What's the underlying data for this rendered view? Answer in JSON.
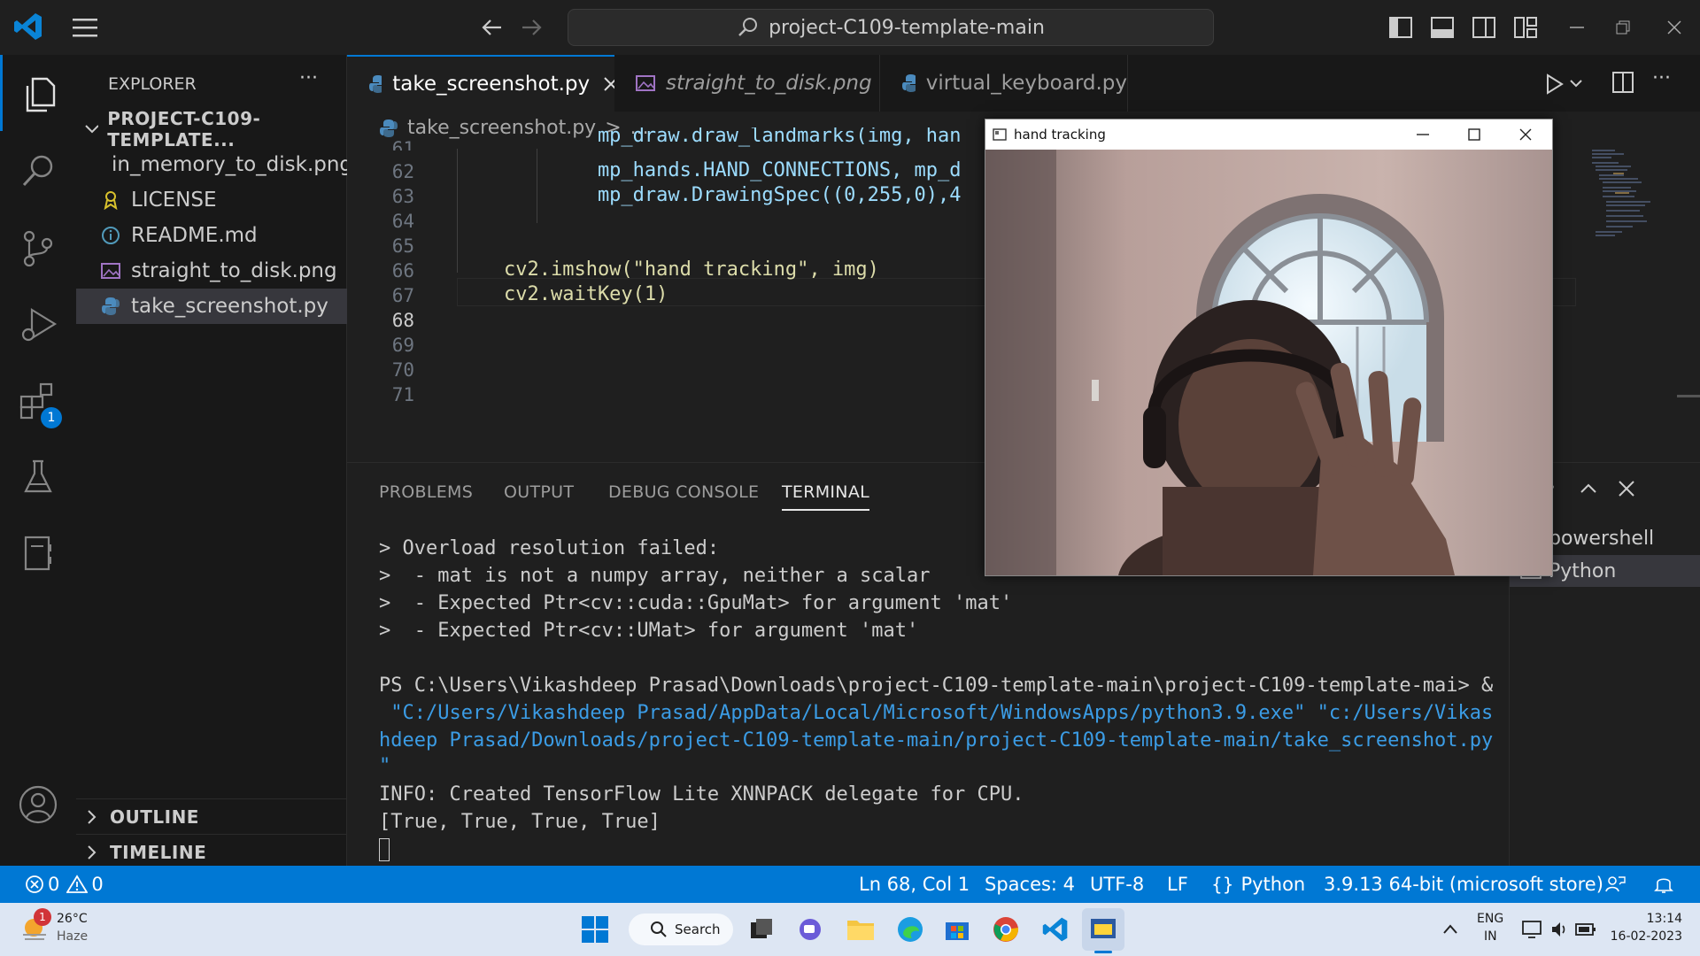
{
  "titlebar": {
    "search_text": "project-C109-template-main"
  },
  "activity_bar": {
    "extensions_badge": "1"
  },
  "sidebar": {
    "title": "EXPLORER",
    "more": "···",
    "project": "PROJECT-C109-TEMPLATE...",
    "files": [
      {
        "name": "in_memory_to_disk.png",
        "icon": "image-file-icon"
      },
      {
        "name": "LICENSE",
        "icon": "license-file-icon"
      },
      {
        "name": "README.md",
        "icon": "info-file-icon"
      },
      {
        "name": "straight_to_disk.png",
        "icon": "image-file-icon"
      },
      {
        "name": "take_screenshot.py",
        "icon": "python-file-icon"
      }
    ],
    "outline": "OUTLINE",
    "timeline": "TIMELINE"
  },
  "tabs": [
    {
      "label": "take_screenshot.py",
      "active": true
    },
    {
      "label": "straight_to_disk.png",
      "active": false
    },
    {
      "label": "virtual_keyboard.py",
      "active": false
    }
  ],
  "breadcrumb": {
    "file": "take_screenshot.py",
    "sep": ">",
    "rest": "..."
  },
  "editor": {
    "lines": [
      {
        "n": "61",
        "code": "            mp_draw.draw_landmarks(img, han"
      },
      {
        "n": "62",
        "code": "            mp_hands.HAND_CONNECTIONS, mp_d"
      },
      {
        "n": "63",
        "code": "            mp_draw.DrawingSpec((0,255,0),4"
      },
      {
        "n": "64",
        "code": ""
      },
      {
        "n": "65",
        "code": ""
      },
      {
        "n": "66",
        "code": "    cv2.imshow(\"hand tracking\", img)"
      },
      {
        "n": "67",
        "code": "    cv2.waitKey(1)"
      },
      {
        "n": "68",
        "code": ""
      },
      {
        "n": "69",
        "code": ""
      },
      {
        "n": "70",
        "code": ""
      },
      {
        "n": "71",
        "code": ""
      }
    ]
  },
  "panel": {
    "tabs": [
      "PROBLEMS",
      "OUTPUT",
      "DEBUG CONSOLE",
      "TERMINAL"
    ],
    "terminals": [
      "powershell",
      "Python"
    ],
    "lines": [
      "> Overload resolution failed:",
      ">  - mat is not a numpy array, neither a scalar",
      ">  - Expected Ptr<cv::cuda::GpuMat> for argument 'mat'",
      ">  - Expected Ptr<cv::UMat> for argument 'mat'",
      "",
      "PS C:\\Users\\Vikashdeep Prasad\\Downloads\\project-C109-template-main\\project-C109-template-mai> &",
      " \"C:/Users/Vikashdeep Prasad/AppData/Local/Microsoft/WindowsApps/python3.9.exe\" \"c:/Users/Vikas",
      "hdeep Prasad/Downloads/project-C109-template-main/project-C109-template-main/take_screenshot.py",
      "\"",
      "INFO: Created TensorFlow Lite XNNPACK delegate for CPU.",
      "[True, True, True, True]"
    ]
  },
  "hand_window": {
    "title": "hand tracking"
  },
  "statusbar": {
    "errors": "0",
    "warnings": "0",
    "position": "Ln 68, Col 1",
    "spaces": "Spaces: 4",
    "encoding": "UTF-8",
    "eol": "LF",
    "language": "Python",
    "interpreter": "3.9.13 64-bit (microsoft store)",
    "colors": {
      "bg": "#0078d4"
    }
  },
  "taskbar": {
    "weather_badge": "1",
    "temp": "26°C",
    "condition": "Haze",
    "search": "Search",
    "lang": "ENG",
    "region": "IN",
    "time": "13:14",
    "date": "16-02-2023"
  }
}
